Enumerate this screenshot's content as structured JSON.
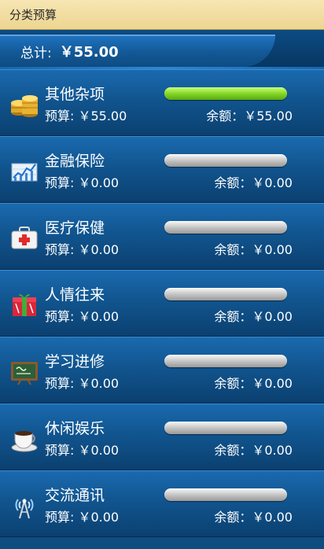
{
  "header": {
    "title": "分类预算"
  },
  "total": {
    "label": "总计:",
    "value": "￥55.00"
  },
  "categories": [
    {
      "name": "其他杂项",
      "budget": "预算: ￥55.00",
      "remaining": "余额：￥55.00",
      "progress": 1.0,
      "icon": "coins-icon"
    },
    {
      "name": "金融保险",
      "budget": "预算: ￥0.00",
      "remaining": "余额：￥0.00",
      "progress": 0,
      "icon": "finance-chart-icon"
    },
    {
      "name": "医疗保健",
      "budget": "预算: ￥0.00",
      "remaining": "余额：￥0.00",
      "progress": 0,
      "icon": "medical-kit-icon"
    },
    {
      "name": "人情往来",
      "budget": "预算: ￥0.00",
      "remaining": "余额：￥0.00",
      "progress": 0,
      "icon": "gift-icon"
    },
    {
      "name": "学习进修",
      "budget": "预算: ￥0.00",
      "remaining": "余额：￥0.00",
      "progress": 0,
      "icon": "chalkboard-icon"
    },
    {
      "name": "休闲娱乐",
      "budget": "预算: ￥0.00",
      "remaining": "余额：￥0.00",
      "progress": 0,
      "icon": "coffee-cup-icon"
    },
    {
      "name": "交流通讯",
      "budget": "预算: ￥0.00",
      "remaining": "余额：￥0.00",
      "progress": 0,
      "icon": "signal-tower-icon"
    }
  ]
}
